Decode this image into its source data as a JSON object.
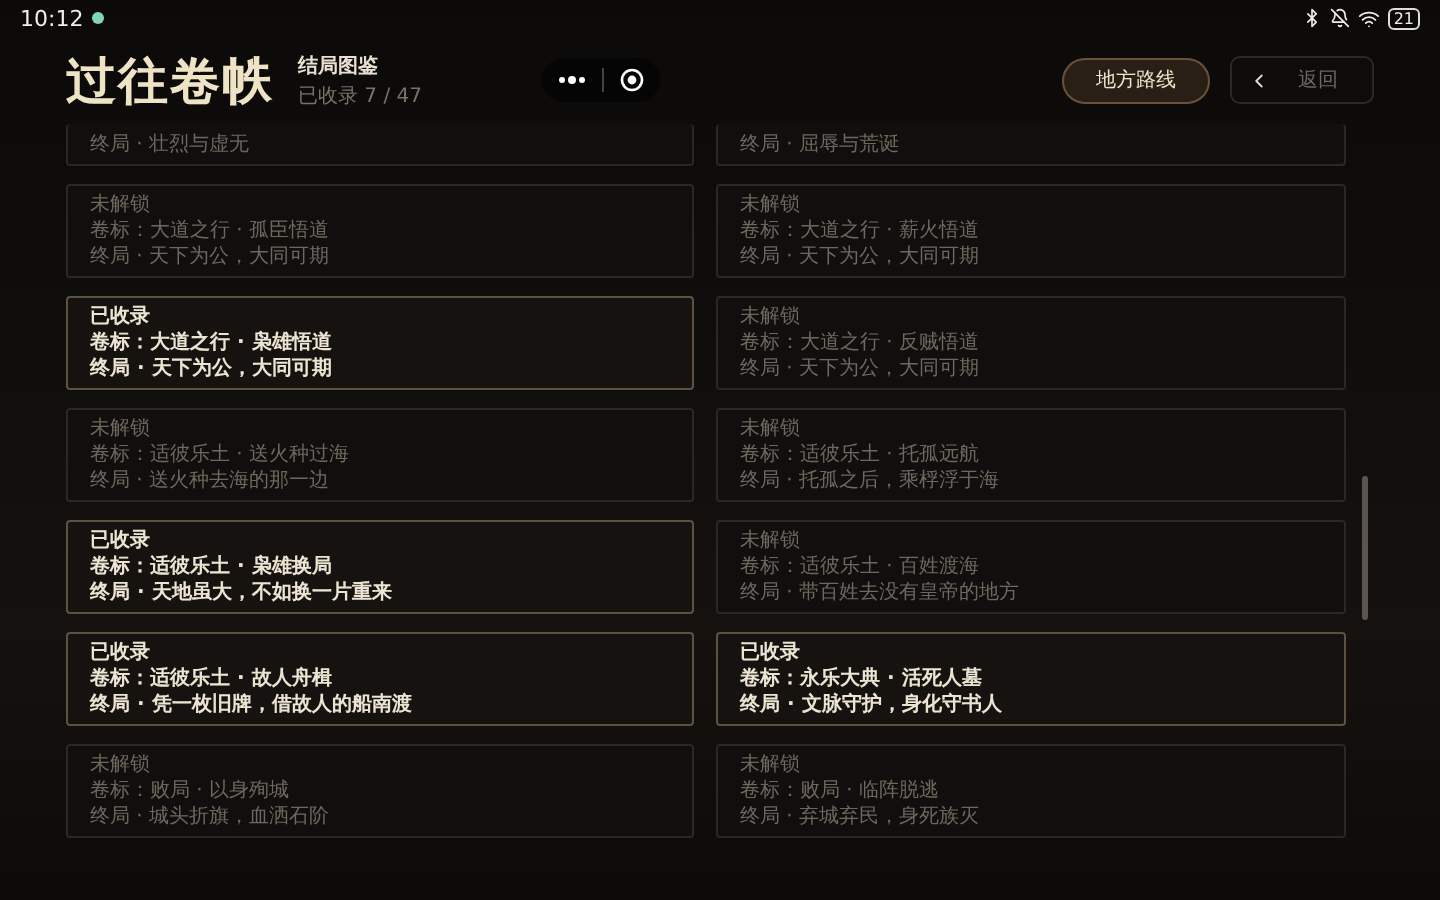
{
  "status_bar": {
    "time": "10:12",
    "battery": "21"
  },
  "header": {
    "title": "过往卷帙",
    "subtitle": "结局图鉴",
    "progress": "已收录 7 / 47",
    "route_button": "地方路线",
    "back_button": "返回"
  },
  "cards": [
    {
      "kind": "partial",
      "collected": false,
      "ending": "终局 · 壮烈与虚无"
    },
    {
      "kind": "partial",
      "collected": false,
      "ending": "终局 · 屈辱与荒诞"
    },
    {
      "kind": "full",
      "collected": false,
      "status": "未解锁",
      "volume": "卷标：大道之行 · 孤臣悟道",
      "ending": "终局 · 天下为公，大同可期"
    },
    {
      "kind": "full",
      "collected": false,
      "status": "未解锁",
      "volume": "卷标：大道之行 · 薪火悟道",
      "ending": "终局 · 天下为公，大同可期"
    },
    {
      "kind": "full",
      "collected": true,
      "status": "已收录",
      "volume": "卷标：大道之行 · 枭雄悟道",
      "ending": "终局 · 天下为公，大同可期"
    },
    {
      "kind": "full",
      "collected": false,
      "status": "未解锁",
      "volume": "卷标：大道之行 · 反贼悟道",
      "ending": "终局 · 天下为公，大同可期"
    },
    {
      "kind": "full",
      "collected": false,
      "status": "未解锁",
      "volume": "卷标：适彼乐土 · 送火种过海",
      "ending": "终局 · 送火种去海的那一边"
    },
    {
      "kind": "full",
      "collected": false,
      "status": "未解锁",
      "volume": "卷标：适彼乐土 · 托孤远航",
      "ending": "终局 · 托孤之后，乘桴浮于海"
    },
    {
      "kind": "full",
      "collected": true,
      "status": "已收录",
      "volume": "卷标：适彼乐土 · 枭雄换局",
      "ending": "终局 · 天地虽大，不如换一片重来"
    },
    {
      "kind": "full",
      "collected": false,
      "status": "未解锁",
      "volume": "卷标：适彼乐土 · 百姓渡海",
      "ending": "终局 · 带百姓去没有皇帝的地方"
    },
    {
      "kind": "full",
      "collected": true,
      "status": "已收录",
      "volume": "卷标：适彼乐土 · 故人舟楫",
      "ending": "终局 · 凭一枚旧牌，借故人的船南渡"
    },
    {
      "kind": "full",
      "collected": true,
      "status": "已收录",
      "volume": "卷标：永乐大典 · 活死人墓",
      "ending": "终局 · 文脉守护，身化守书人"
    },
    {
      "kind": "full",
      "collected": false,
      "status": "未解锁",
      "volume": "卷标：败局 · 以身殉城",
      "ending": "终局 · 城头折旗，血洒石阶"
    },
    {
      "kind": "full",
      "collected": false,
      "status": "未解锁",
      "volume": "卷标：败局 · 临阵脱逃",
      "ending": "终局 · 弃城弃民，身死族灭"
    }
  ]
}
